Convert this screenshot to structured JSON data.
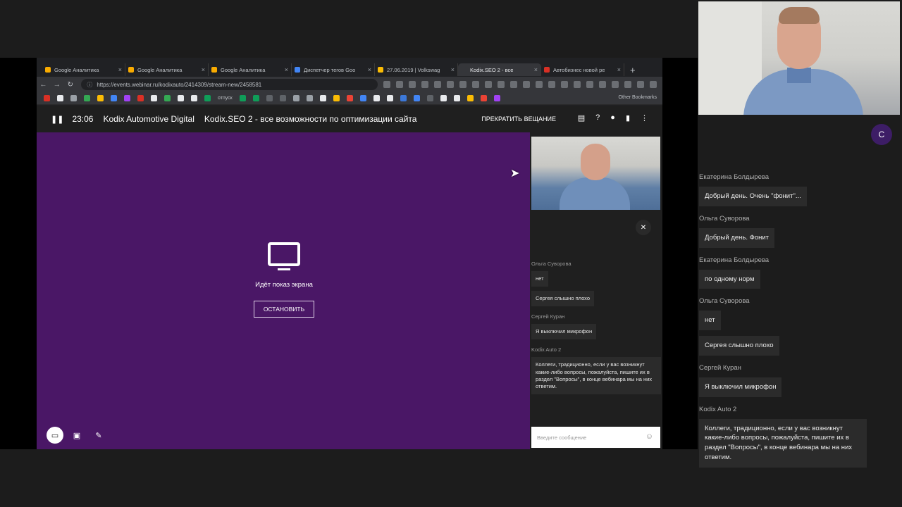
{
  "browser": {
    "tabs": [
      {
        "title": "Google Аналитика",
        "color": "#f9ab00"
      },
      {
        "title": "Google Аналитика",
        "color": "#f9ab00"
      },
      {
        "title": "Google Аналитика",
        "color": "#f9ab00"
      },
      {
        "title": "Диспетчер тегов Goo",
        "color": "#4285f4"
      },
      {
        "title": "27.06.2019 | Volkswag",
        "color": "#fbbc04"
      },
      {
        "title": "Kodix.SEO 2 - все",
        "color": "#35363a",
        "active": true
      },
      {
        "title": "Автобизнес новой ре",
        "color": "#d93025"
      }
    ],
    "url": "https://events.webinar.ru/kodixauto/2414309/stream-new/2458581",
    "bookmark_label": "отпуск",
    "other_bookmarks": "Other Bookmarks"
  },
  "webinar": {
    "time": "23:06",
    "brand": "Kodix Automotive Digital",
    "title": "Kodix.SEO 2 - все возможности по оптимизации сайта",
    "stop_broadcast": "ПРЕКРАТИТЬ ВЕЩАНИЕ",
    "sharing_text": "Идёт показ экрана",
    "stop_button": "ОСТАНОВИТЬ",
    "input_placeholder": "Введите сообщение"
  },
  "inner_chat": [
    {
      "author": "Ольга Суворова",
      "messages": [
        "нет",
        "Сергея слышно плохо"
      ]
    },
    {
      "author": "Сергей Куран",
      "messages": [
        "Я выключил микрофон"
      ]
    },
    {
      "author": "Kodix Auto 2",
      "messages": [
        "Коллеги, традиционно, если у вас возникнут какие-либо вопросы, пожалуйста, пишите их в раздел \"Вопросы\", в конце вебинара мы на них ответим."
      ]
    }
  ],
  "outer": {
    "avatar_letter": "С",
    "chat": [
      {
        "author": "Екатерина Болдырева",
        "messages": [
          "Добрый день. Очень \"фонит\"..."
        ]
      },
      {
        "author": "Ольга Суворова",
        "messages": [
          "Добрый день. Фонит"
        ]
      },
      {
        "author": "Екатерина Болдырева",
        "messages": [
          "по одному норм"
        ]
      },
      {
        "author": "Ольга Суворова",
        "messages": [
          "нет",
          "Сергея слышно плохо"
        ]
      },
      {
        "author": "Сергей Куран",
        "messages": [
          "Я выключил микрофон"
        ]
      },
      {
        "author": "Kodix Auto 2",
        "messages": [
          "Коллеги, традиционно, если у вас возникнут какие-либо вопросы, пожалуйста, пишите их в раздел \"Вопросы\", в конце вебинара мы на них ответим."
        ]
      }
    ]
  },
  "icons": {
    "pause": "pause-icon",
    "chat": "chat-icon",
    "questions": "questions-icon",
    "participants": "participants-icon",
    "files": "files-icon",
    "more": "more-icon",
    "mute": "microphone-muted-icon",
    "emoji": "emoji-icon"
  }
}
